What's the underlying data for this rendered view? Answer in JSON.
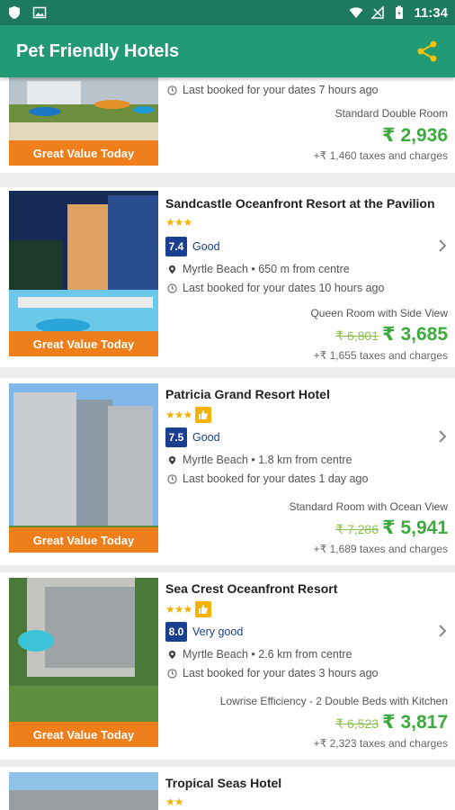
{
  "status_bar": {
    "time": "11:34",
    "colors": {
      "bar": "#1e7a5e"
    }
  },
  "app_bar": {
    "title": "Pet Friendly Hotels",
    "share_icon": "share-icon",
    "colors": {
      "bar": "#239a76",
      "share": "#f5c400"
    }
  },
  "deal_label": "Great Value Today",
  "currency": "₹",
  "hotels": [
    {
      "name": "",
      "stars": "",
      "score": "",
      "rating_text": "",
      "distance": "",
      "last_booked": "Last booked for your dates 7 hours ago",
      "room_type": "Standard Double Room",
      "old_price": "",
      "price": "₹ 2,936",
      "taxes": "+₹ 1,460 taxes and charges"
    },
    {
      "name": "Sandcastle Oceanfront Resort at the Pavilion",
      "stars": "★★★",
      "thumbs_up": false,
      "score": "7.4",
      "rating_text": "Good",
      "distance": "Myrtle Beach • 650 m from centre",
      "last_booked": "Last booked for your dates 10 hours ago",
      "room_type": "Queen Room with Side View",
      "old_price": "₹ 6,801",
      "price": "₹ 3,685",
      "taxes": "+₹ 1,655 taxes and charges"
    },
    {
      "name": "Patricia Grand Resort Hotel",
      "stars": "★★★",
      "thumbs_up": true,
      "score": "7.5",
      "rating_text": "Good",
      "distance": "Myrtle Beach • 1.8 km from centre",
      "last_booked": "Last booked for your dates 1 day ago",
      "room_type": "Standard Room with Ocean View",
      "old_price": "₹ 7,286",
      "price": "₹ 5,941",
      "taxes": "+₹ 1,689 taxes and charges"
    },
    {
      "name": "Sea Crest Oceanfront Resort",
      "stars": "★★★",
      "thumbs_up": true,
      "score": "8.0",
      "rating_text": "Very good",
      "distance": "Myrtle Beach • 2.6 km from centre",
      "last_booked": "Last booked for your dates 3 hours ago",
      "room_type": "Lowrise Efficiency - 2 Double Beds with Kitchen",
      "old_price": "₹ 6,523",
      "price": "₹ 3,817",
      "taxes": "+₹ 2,323 taxes and charges"
    },
    {
      "name": "Tropical Seas Hotel",
      "stars": "★★"
    }
  ]
}
